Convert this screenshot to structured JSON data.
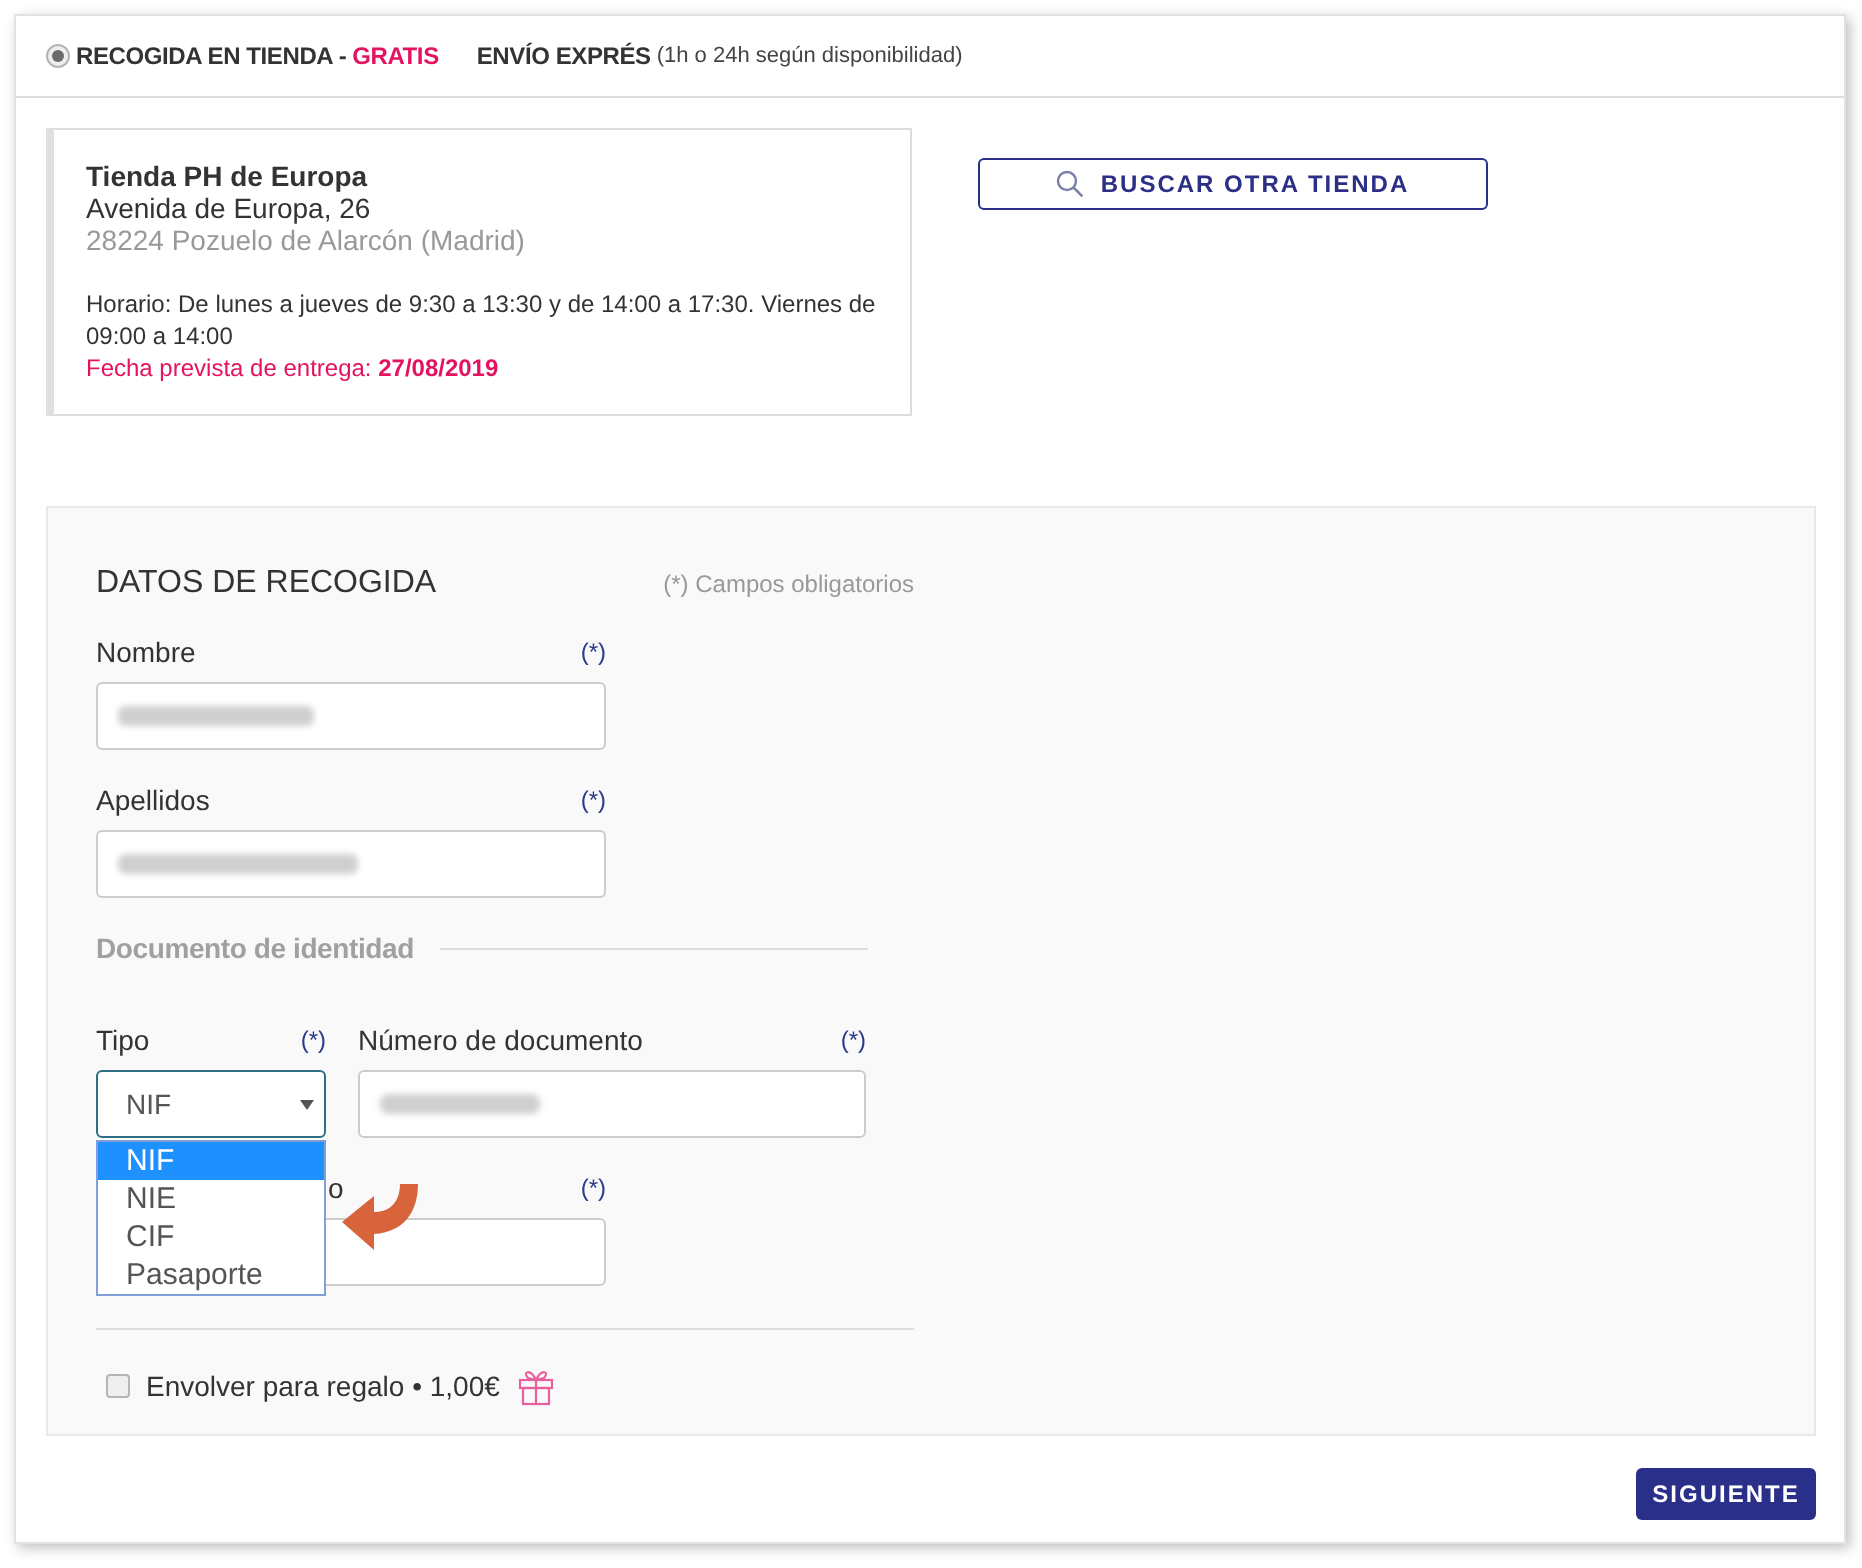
{
  "delivery_options": [
    {
      "label": "RECOGIDA EN TIENDA -",
      "price": "GRATIS",
      "selected": true
    },
    {
      "label": "ENVÍO EXPRÉS",
      "note": "(1h o 24h según disponibilidad)",
      "selected": false
    }
  ],
  "store": {
    "name": "Tienda PH de Europa",
    "address": "Avenida de Europa, 26",
    "city": "28224 Pozuelo de Alarcón (Madrid)",
    "schedule": "Horario: De lunes a jueves de 9:30 a 13:30 y de 14:00 a 17:30. Viernes de 09:00 a 14:00",
    "delivery": "Fecha prevista de entrega: **27/08/2019**"
  },
  "search_button": {
    "label": "BUSCAR OTRA TIENDA"
  },
  "form": {
    "title": "DATOS DE RECOGIDA",
    "required_note": "(*) Campos obligatorios",
    "fields": [
      {
        "label": "Nombre",
        "required_mark": "(*)",
        "blurred": true
      },
      {
        "label": "Apellidos",
        "required_mark": "(*)",
        "blurred": true
      }
    ],
    "section_title": "Documento de identidad",
    "document_type": {
      "label": "Tipo",
      "required_mark": "(*)",
      "value": "NIF",
      "expanded": true,
      "options": [
        {
          "label": "NIF",
          "selected": true
        },
        {
          "label": "NIE",
          "selected": false
        },
        {
          "label": "CIF",
          "selected": false
        },
        {
          "label": "Pasaporte",
          "selected": false
        }
      ]
    },
    "document_number": {
      "label": "Número de documento",
      "required_mark": "(*)",
      "blurred": true
    },
    "extra_field": {
      "label": "o",
      "required_mark": "(*)",
      "blurred": false
    },
    "gift_wrap": {
      "label": "Envolver para regalo • 1,00€",
      "checked": false
    }
  },
  "next_button": {
    "label": "SIGUIENTE"
  }
}
